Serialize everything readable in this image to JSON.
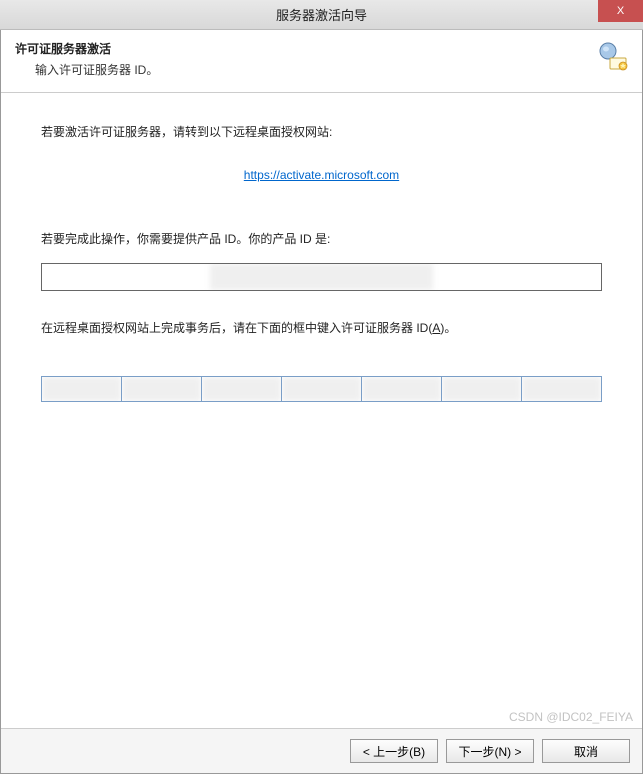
{
  "window": {
    "title": "服务器激活向导",
    "close_symbol": "X"
  },
  "header": {
    "heading": "许可证服务器激活",
    "subheading": "输入许可证服务器 ID。",
    "icon_name": "license-wizard-icon"
  },
  "body": {
    "instruction_activate": "若要激活许可证服务器，请转到以下远程桌面授权网站:",
    "link_text": "https://activate.microsoft.com",
    "instruction_product_id": "若要完成此操作，你需要提供产品 ID。你的产品 ID 是:",
    "product_id_value": "",
    "instruction_enter_id_pre": "在远程桌面授权网站上完成事务后，请在下面的框中键入许可证服务器 ID(",
    "instruction_enter_id_key": "A",
    "instruction_enter_id_post": ")。",
    "id_segments": [
      "",
      "",
      "",
      "",
      "",
      "",
      ""
    ]
  },
  "buttons": {
    "back": "< 上一步(B)",
    "next": "下一步(N) >",
    "cancel": "取消"
  },
  "watermark": "CSDN @IDC02_FEIYA"
}
